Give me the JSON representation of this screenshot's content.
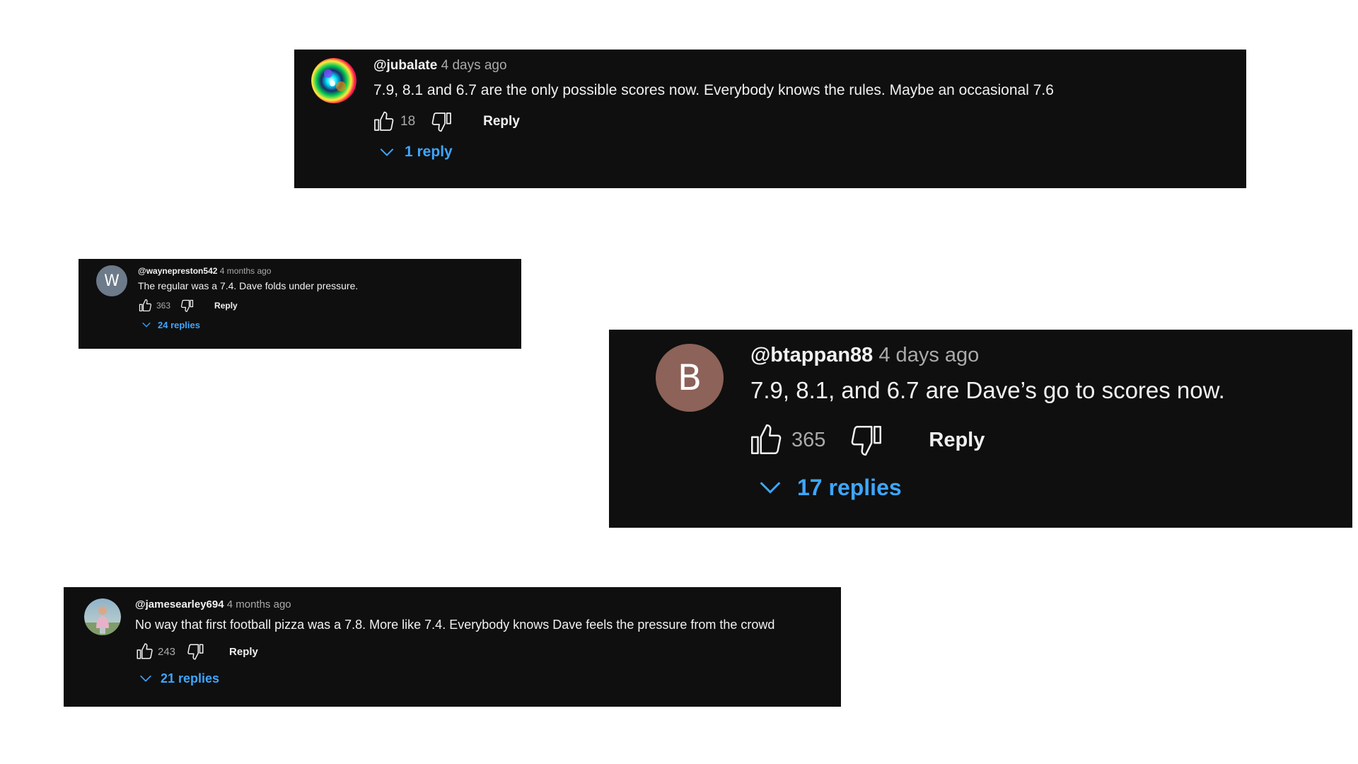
{
  "comments": [
    {
      "handle": "@jubalate",
      "time": "4 days ago",
      "text": "7.9, 8.1 and 6.7 are the only possible scores now. Everybody knows the rules. Maybe an occasional 7.6",
      "likes": "18",
      "reply_label": "Reply",
      "replies_label": "1 reply",
      "avatar": "colorful-avatar"
    },
    {
      "handle": "@waynepreston542",
      "time": "4 months ago",
      "text": "The regular was a 7.4.  Dave folds under pressure.",
      "likes": "363",
      "reply_label": "Reply",
      "replies_label": "24 replies",
      "avatar_letter": "W"
    },
    {
      "handle": "@btappan88",
      "time": "4 days ago",
      "text": "7.9, 8.1, and 6.7 are Dave’s go to scores now.",
      "likes": "365",
      "reply_label": "Reply",
      "replies_label": "17 replies",
      "avatar_letter": "B"
    },
    {
      "handle": "@jamesearley694",
      "time": "4 months ago",
      "text": "No way that first football pizza was a 7.8. More like 7.4. Everybody knows Dave feels the pressure from the crowd",
      "likes": "243",
      "reply_label": "Reply",
      "replies_label": "21 replies",
      "avatar": "photo-avatar"
    }
  ],
  "colors": {
    "card_bg": "#0f0f0f",
    "text": "#f1f1f1",
    "muted": "#aaaaaa",
    "link": "#3ea6ff",
    "avatar_w": "#6c7a89",
    "avatar_b": "#8d6258"
  }
}
